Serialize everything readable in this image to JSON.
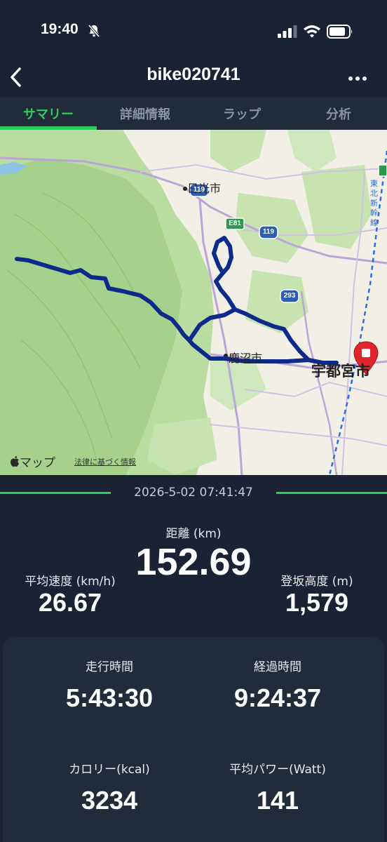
{
  "status_bar": {
    "time": "19:40"
  },
  "nav": {
    "title": "bike020741"
  },
  "tabs": [
    {
      "label": "サマリー",
      "active": true
    },
    {
      "label": "詳細情報",
      "active": false
    },
    {
      "label": "ラップ",
      "active": false
    },
    {
      "label": "分析",
      "active": false
    }
  ],
  "map": {
    "labels": {
      "nikko": "日光市",
      "kanuma": "鹿沼市",
      "utsunomiya": "宇都宮市",
      "shinkansen": "東北新幹線",
      "e81": "E81",
      "r119a": "119",
      "r119b": "119",
      "r293": "293"
    },
    "attribution": "マップ",
    "legal": "法律に基づく情報"
  },
  "ride": {
    "datetime": "2026-5-02 07:41:47"
  },
  "stats": {
    "distance": {
      "label": "距離 (km)",
      "value": "152.69"
    },
    "avg_speed": {
      "label": "平均速度 (km/h)",
      "value": "26.67"
    },
    "elevation": {
      "label": "登坂高度 (m)",
      "value": "1,579"
    },
    "moving_time": {
      "label": "走行時間",
      "value": "5:43:30"
    },
    "elapsed_time": {
      "label": "経過時間",
      "value": "9:24:37"
    },
    "calories": {
      "label": "カロリー(kcal)",
      "value": "3234"
    },
    "avg_power": {
      "label": "平均パワー(Watt)",
      "value": "141"
    }
  },
  "colors": {
    "accent": "#2ecc5c",
    "route": "#0c2a8a",
    "background": "#1a2233",
    "card": "#222b3a"
  }
}
